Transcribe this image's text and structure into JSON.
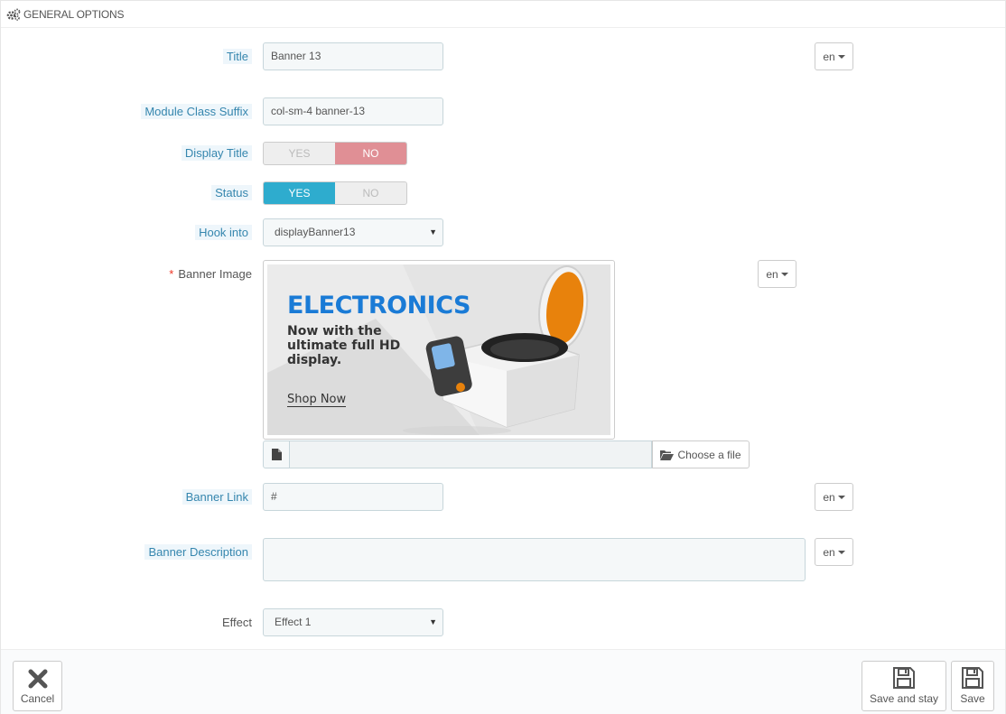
{
  "panel": {
    "heading": "GENERAL OPTIONS"
  },
  "form": {
    "title": {
      "label": "Title",
      "value": "Banner 13",
      "lang": "en"
    },
    "module_class_suffix": {
      "label": "Module Class Suffix",
      "value": "col-sm-4 banner-13"
    },
    "display_title": {
      "label": "Display Title",
      "yes": "YES",
      "no": "NO",
      "selected": "NO"
    },
    "status": {
      "label": "Status",
      "yes": "YES",
      "no": "NO",
      "selected": "YES"
    },
    "hook_into": {
      "label": "Hook into",
      "value": "displayBanner13"
    },
    "banner_image": {
      "label": "Banner Image",
      "required_mark": "*",
      "lang": "en",
      "preview": {
        "title": "ELECTRONICS",
        "subtitle": "Now with the ultimate full HD display.",
        "link": "Shop Now"
      },
      "choose_file": "Choose a file"
    },
    "banner_link": {
      "label": "Banner Link",
      "value": "#",
      "lang": "en"
    },
    "banner_description": {
      "label": "Banner Description",
      "value": "",
      "lang": "en"
    },
    "effect": {
      "label": "Effect",
      "value": "Effect 1"
    }
  },
  "footer": {
    "cancel": "Cancel",
    "save_and_stay": "Save and stay",
    "save": "Save"
  },
  "colors": {
    "yes_active": "#2eacce",
    "no_active": "#e08f95",
    "hint_label_bg": "#eef6fb",
    "hint_label_text": "#3586ae",
    "banner_title": "#1a7bd6",
    "appliance_lid": "#e8820c"
  }
}
